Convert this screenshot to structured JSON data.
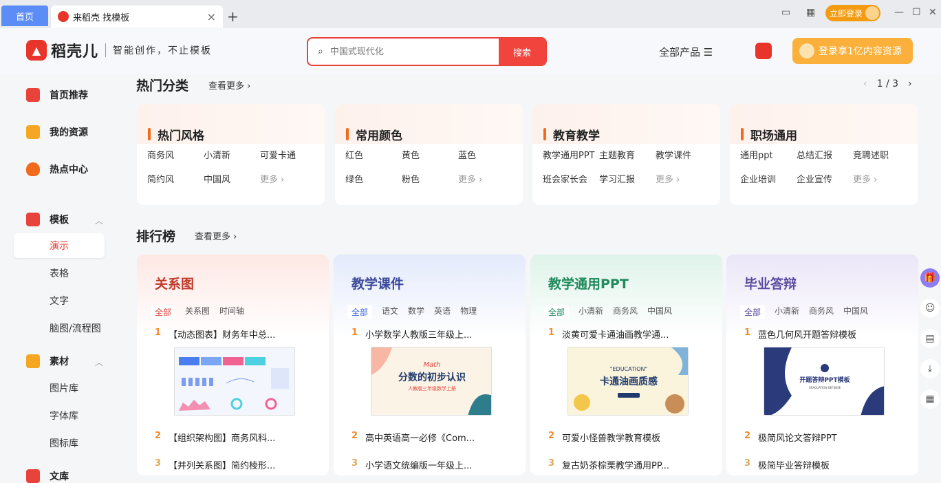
{
  "tabs": {
    "home": "首页",
    "active": "来稻壳 找模板",
    "close": "×",
    "add": "+"
  },
  "titlebar": {
    "login": "立即登录"
  },
  "header": {
    "brand_name": "稻壳儿",
    "slogan": "智能创作，不止模板",
    "search_placeholder": "中国式现代化",
    "search_button": "搜索",
    "all_products": "全部产品 ☰",
    "login_button": "登录享1亿内容资源"
  },
  "sidebar": {
    "home": "首页推荐",
    "resources": "我的资源",
    "hot": "热点中心",
    "templates": "模板",
    "tpl_items": [
      "演示",
      "表格",
      "文字",
      "脑图/流程图"
    ],
    "materials": "素材",
    "mat_items": [
      "图片库",
      "字体库",
      "图标库"
    ],
    "library": "文库"
  },
  "hot_categories": {
    "title": "热门分类",
    "more": "查看更多 ›",
    "pager": "1 / 3",
    "cards": [
      {
        "title": "热门风格",
        "links": [
          "商务风",
          "小清新",
          "可爱卡通",
          "简约风",
          "中国风"
        ],
        "more": "更多 ›"
      },
      {
        "title": "常用颜色",
        "links": [
          "红色",
          "黄色",
          "蓝色",
          "绿色",
          "粉色"
        ],
        "more": "更多 ›"
      },
      {
        "title": "教育教学",
        "links": [
          "教学通用PPT",
          "主题教育",
          "教学课件",
          "班会家长会",
          "学习汇报"
        ],
        "more": "更多 ›"
      },
      {
        "title": "职场通用",
        "links": [
          "通用ppt",
          "总结汇报",
          "竞聘述职",
          "企业培训",
          "企业宣传"
        ],
        "more": "更多 ›"
      }
    ]
  },
  "ranking": {
    "title": "排行榜",
    "more": "查看更多 ›",
    "columns": [
      {
        "title": "关系图",
        "tabs": [
          "全部",
          "关系图",
          "时间轴"
        ],
        "items": [
          "【动态图表】财务年中总...",
          "【组织架构图】商务风科...",
          "【并列关系图】简约棱形..."
        ],
        "color": "#c0392b"
      },
      {
        "title": "教学课件",
        "tabs": [
          "全部",
          "语文",
          "数学",
          "英语",
          "物理"
        ],
        "items": [
          "小学数学人教版三年级上...",
          "高中英语高一必修《Com...",
          "小学语文统编版一年级上..."
        ],
        "color": "#3b4a9a"
      },
      {
        "title": "教学通用PPT",
        "tabs": [
          "全部",
          "小清新",
          "商务风",
          "中国风"
        ],
        "items": [
          "淡黄可爱卡通油画教学通...",
          "可爱小怪兽教学教育模板",
          "复古奶茶棕栗教学通用PP..."
        ],
        "color": "#1f8a5c"
      },
      {
        "title": "毕业答辩",
        "tabs": [
          "全部",
          "小清新",
          "商务风",
          "中国风"
        ],
        "items": [
          "蓝色几何风开题答辩模板",
          "极简风论文答辩PPT",
          "极简毕业答辩模板"
        ],
        "color": "#5a4aa0"
      }
    ],
    "thumb_texts": {
      "math_tag": "Math",
      "math_title": "分数的初步认识",
      "math_sub": "人教版三年级数学上册",
      "edu_tag": "\"EDUCATION\"",
      "edu_title": "卡通油画质感",
      "grad_title": "开题答辩PPT模板",
      "grad_sub": "GRADUATION DEFENSE"
    }
  },
  "ranks": [
    "1",
    "2",
    "3"
  ]
}
